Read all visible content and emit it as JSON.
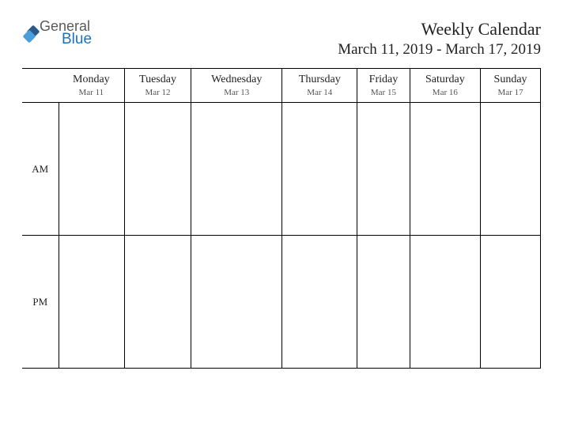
{
  "logo": {
    "general": "General",
    "blue": "Blue"
  },
  "header": {
    "title": "Weekly Calendar",
    "date_range": "March 11, 2019 - March 17, 2019"
  },
  "days": [
    {
      "name": "Monday",
      "date": "Mar 11"
    },
    {
      "name": "Tuesday",
      "date": "Mar 12"
    },
    {
      "name": "Wednesday",
      "date": "Mar 13"
    },
    {
      "name": "Thursday",
      "date": "Mar 14"
    },
    {
      "name": "Friday",
      "date": "Mar 15"
    },
    {
      "name": "Saturday",
      "date": "Mar 16"
    },
    {
      "name": "Sunday",
      "date": "Mar 17"
    }
  ],
  "rows": {
    "am": "AM",
    "pm": "PM"
  }
}
